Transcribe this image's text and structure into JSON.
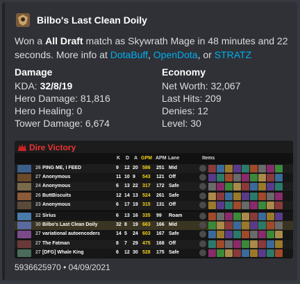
{
  "author": {
    "name": "Bilbo's Last Clean Doily",
    "avatar_icon": "dota-hero-avatar-icon"
  },
  "description": {
    "prefix": "Won a ",
    "mode": "All Draft",
    "middle": " match as Skywrath Mage in 48 minutes and 22 seconds. More info at ",
    "links": [
      "DotaBuff",
      "OpenDota",
      "STRATZ"
    ],
    "sep1": ", ",
    "sep2": ", or "
  },
  "damage": {
    "heading": "Damage",
    "kda_label": "KDA: ",
    "kda_value": "32/8/19",
    "hero_damage": "Hero Damage: 81,816",
    "hero_healing": "Hero Healing: 0",
    "tower_damage": "Tower Damage: 6,674"
  },
  "economy": {
    "heading": "Economy",
    "net_worth": "Net Worth: 32,067",
    "last_hits": "Last Hits: 209",
    "denies": "Denies: 12",
    "level": "Level: 30"
  },
  "scoreboard": {
    "result": "Dire Victory",
    "result_color": "#e33",
    "columns": {
      "k": "K",
      "d": "D",
      "a": "A",
      "gpm": "GPM",
      "apm": "APM",
      "lane": "Lane",
      "items": "Items"
    },
    "rows": [
      {
        "level": "26",
        "name": "PING ME, I FEED",
        "k": "9",
        "d": "12",
        "a": "20",
        "gpm": "586",
        "apm": "251",
        "lane": "Mid",
        "hero_color": "#3a5f8a"
      },
      {
        "level": "27",
        "name": "Anonymous",
        "k": "11",
        "d": "10",
        "a": "9",
        "gpm": "543",
        "apm": "121",
        "lane": "Off",
        "hero_color": "#6b4a2a"
      },
      {
        "level": "24",
        "name": "Anonymous",
        "k": "6",
        "d": "13",
        "a": "22",
        "gpm": "317",
        "apm": "172",
        "lane": "Safe",
        "hero_color": "#7a6a4a"
      },
      {
        "level": "26",
        "name": "ButtBiscuits",
        "k": "12",
        "d": "14",
        "a": "13",
        "gpm": "524",
        "apm": "261",
        "lane": "Safe",
        "hero_color": "#8a5a3a"
      },
      {
        "level": "23",
        "name": "Anonymous",
        "k": "6",
        "d": "17",
        "a": "19",
        "gpm": "315",
        "apm": "131",
        "lane": "Off",
        "hero_color": "#5a4a3a"
      },
      {
        "level": "22",
        "name": "Sirius",
        "k": "6",
        "d": "13",
        "a": "16",
        "gpm": "335",
        "apm": "99",
        "lane": "Roam",
        "hero_color": "#4a7aaa"
      },
      {
        "level": "30",
        "name": "Bilbo's Last Clean Doily",
        "k": "32",
        "d": "8",
        "a": "19",
        "gpm": "663",
        "apm": "166",
        "lane": "Mid",
        "hero_color": "#5a6aa0"
      },
      {
        "level": "27",
        "name": "variational autoencoders",
        "k": "14",
        "d": "5",
        "a": "24",
        "gpm": "603",
        "apm": "167",
        "lane": "Safe",
        "hero_color": "#7a4a8a"
      },
      {
        "level": "27",
        "name": "The Fatman",
        "k": "8",
        "d": "7",
        "a": "29",
        "gpm": "475",
        "apm": "168",
        "lane": "Off",
        "hero_color": "#6a3a3a"
      },
      {
        "level": "27",
        "name": "[DFG] Whale King",
        "k": "6",
        "d": "12",
        "a": "30",
        "gpm": "528",
        "apm": "175",
        "lane": "Safe",
        "hero_color": "#4a6a5a"
      }
    ]
  },
  "footer": "5936625970 • 04/09/2021"
}
